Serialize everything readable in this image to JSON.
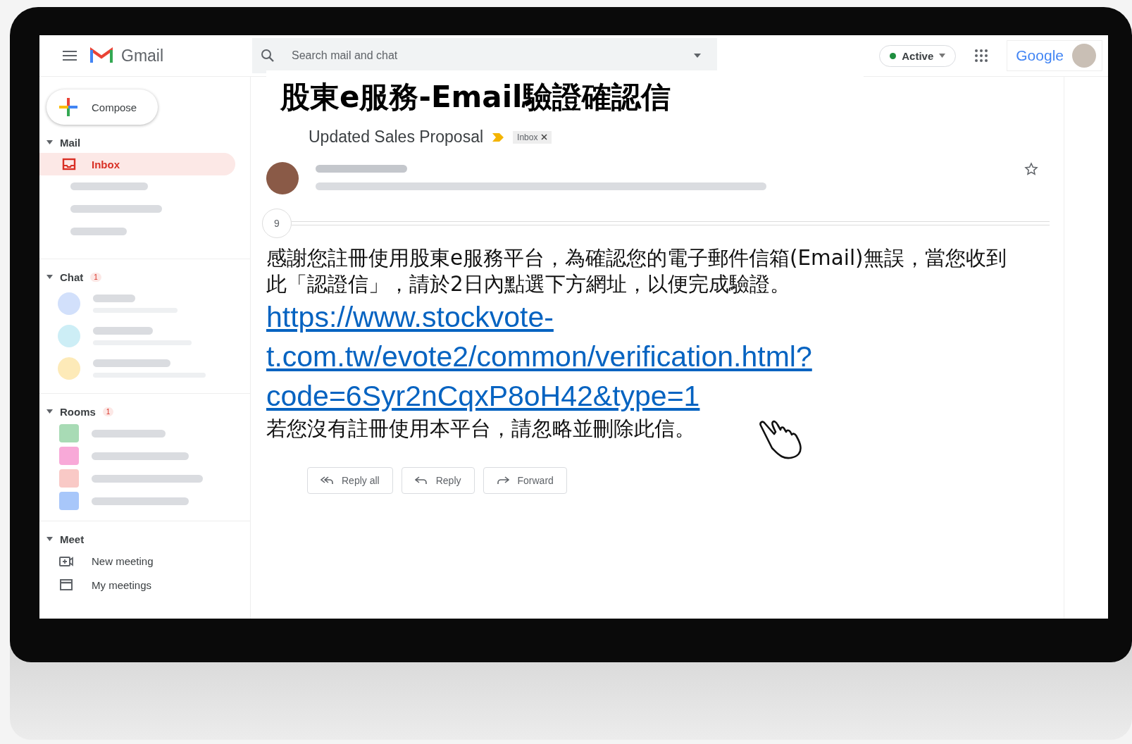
{
  "topbar": {
    "app_name": "Gmail",
    "search": {
      "placeholder": "Search mail and chat"
    },
    "status": "Active",
    "brand": "Google"
  },
  "compose": "Compose",
  "sidebar": [
    {
      "kind": "mail",
      "title": "Mail",
      "items": [
        {
          "label": "Inbox",
          "selected": true
        }
      ]
    },
    {
      "kind": "chat",
      "title": "Chat",
      "badge": "1",
      "placeholders": [
        {
          "color": "#d2e0fb"
        },
        {
          "color": "#cdeef6"
        },
        {
          "color": "#fdeab8"
        }
      ]
    },
    {
      "kind": "rooms",
      "title": "Rooms",
      "badge": "1",
      "placeholders": [
        {
          "color": "#a8dbb5"
        },
        {
          "color": "#f8a9d8"
        },
        {
          "color": "#f9c9c6"
        },
        {
          "color": "#a8c7fa"
        }
      ]
    },
    {
      "kind": "meet",
      "title": "Meet",
      "links": [
        {
          "kind": "new",
          "label": "New meeting"
        },
        {
          "kind": "list",
          "label": "My meetings"
        }
      ]
    }
  ],
  "overlay_title": "股東e服務-Email驗證確認信",
  "email": {
    "subject": "Updated Sales Proposal",
    "label": "Inbox",
    "collapsed_count": "9",
    "body": [
      {
        "kind": "text",
        "text": "感謝您註冊使用股東e服務平台，為確認您的電子郵件信箱(Email)無誤，當您收到此「認證信」，請於2日內點選下方網址，以便完成驗證。"
      },
      {
        "kind": "link",
        "text": "https://www.stockvote-t.com.tw/evote2/common/verification.html?code=6Syr2nCqxP8oH42&type=1"
      },
      {
        "kind": "text",
        "text": "若您沒有註冊使用本平台，請忽略並刪除此信。"
      }
    ],
    "actions": [
      {
        "kind": "reply_all",
        "label": "Reply all"
      },
      {
        "kind": "reply",
        "label": "Reply"
      },
      {
        "kind": "forward",
        "label": "Forward"
      }
    ]
  }
}
